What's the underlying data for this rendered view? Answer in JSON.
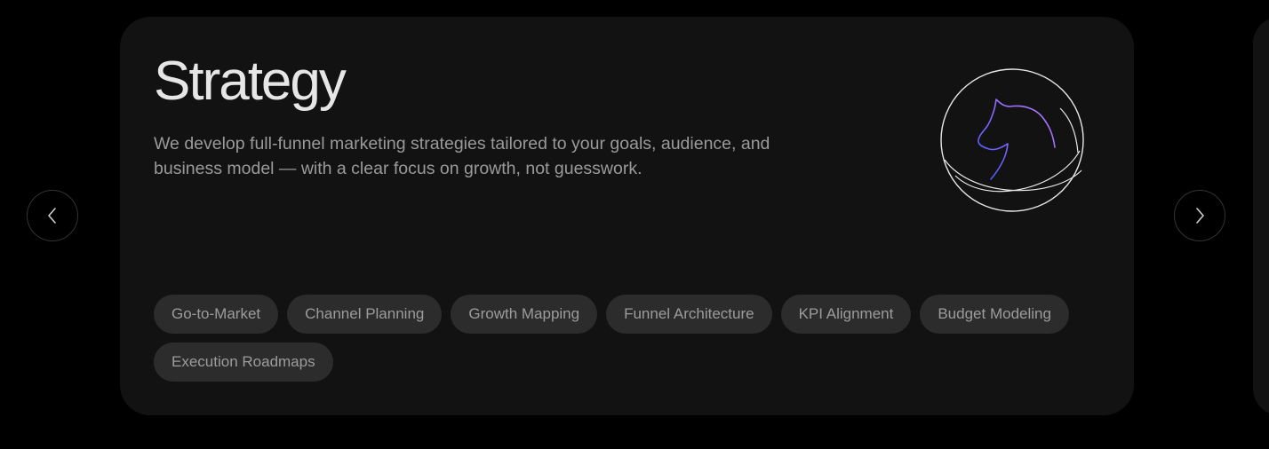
{
  "card": {
    "title": "Strategy",
    "description": "We develop full-funnel marketing strategies tailored to your goals, audience, and business model — with a clear focus on growth, not guesswork.",
    "emblem_icon": "knight-sphere-icon",
    "tags": [
      "Go-to-Market",
      "Channel Planning",
      "Growth Mapping",
      "Funnel Architecture",
      "KPI Alignment",
      "Budget Modeling",
      "Execution Roadmaps"
    ]
  },
  "navigation": {
    "prev_icon": "chevron-left-icon",
    "next_icon": "chevron-right-icon"
  },
  "colors": {
    "background": "#000000",
    "card": "#121212",
    "title": "#e6e6e6",
    "body_text": "#9a9a9a",
    "tag_bg": "#2c2c2c",
    "accent_gradient_start": "#5b5bff",
    "accent_gradient_end": "#b267ff"
  }
}
